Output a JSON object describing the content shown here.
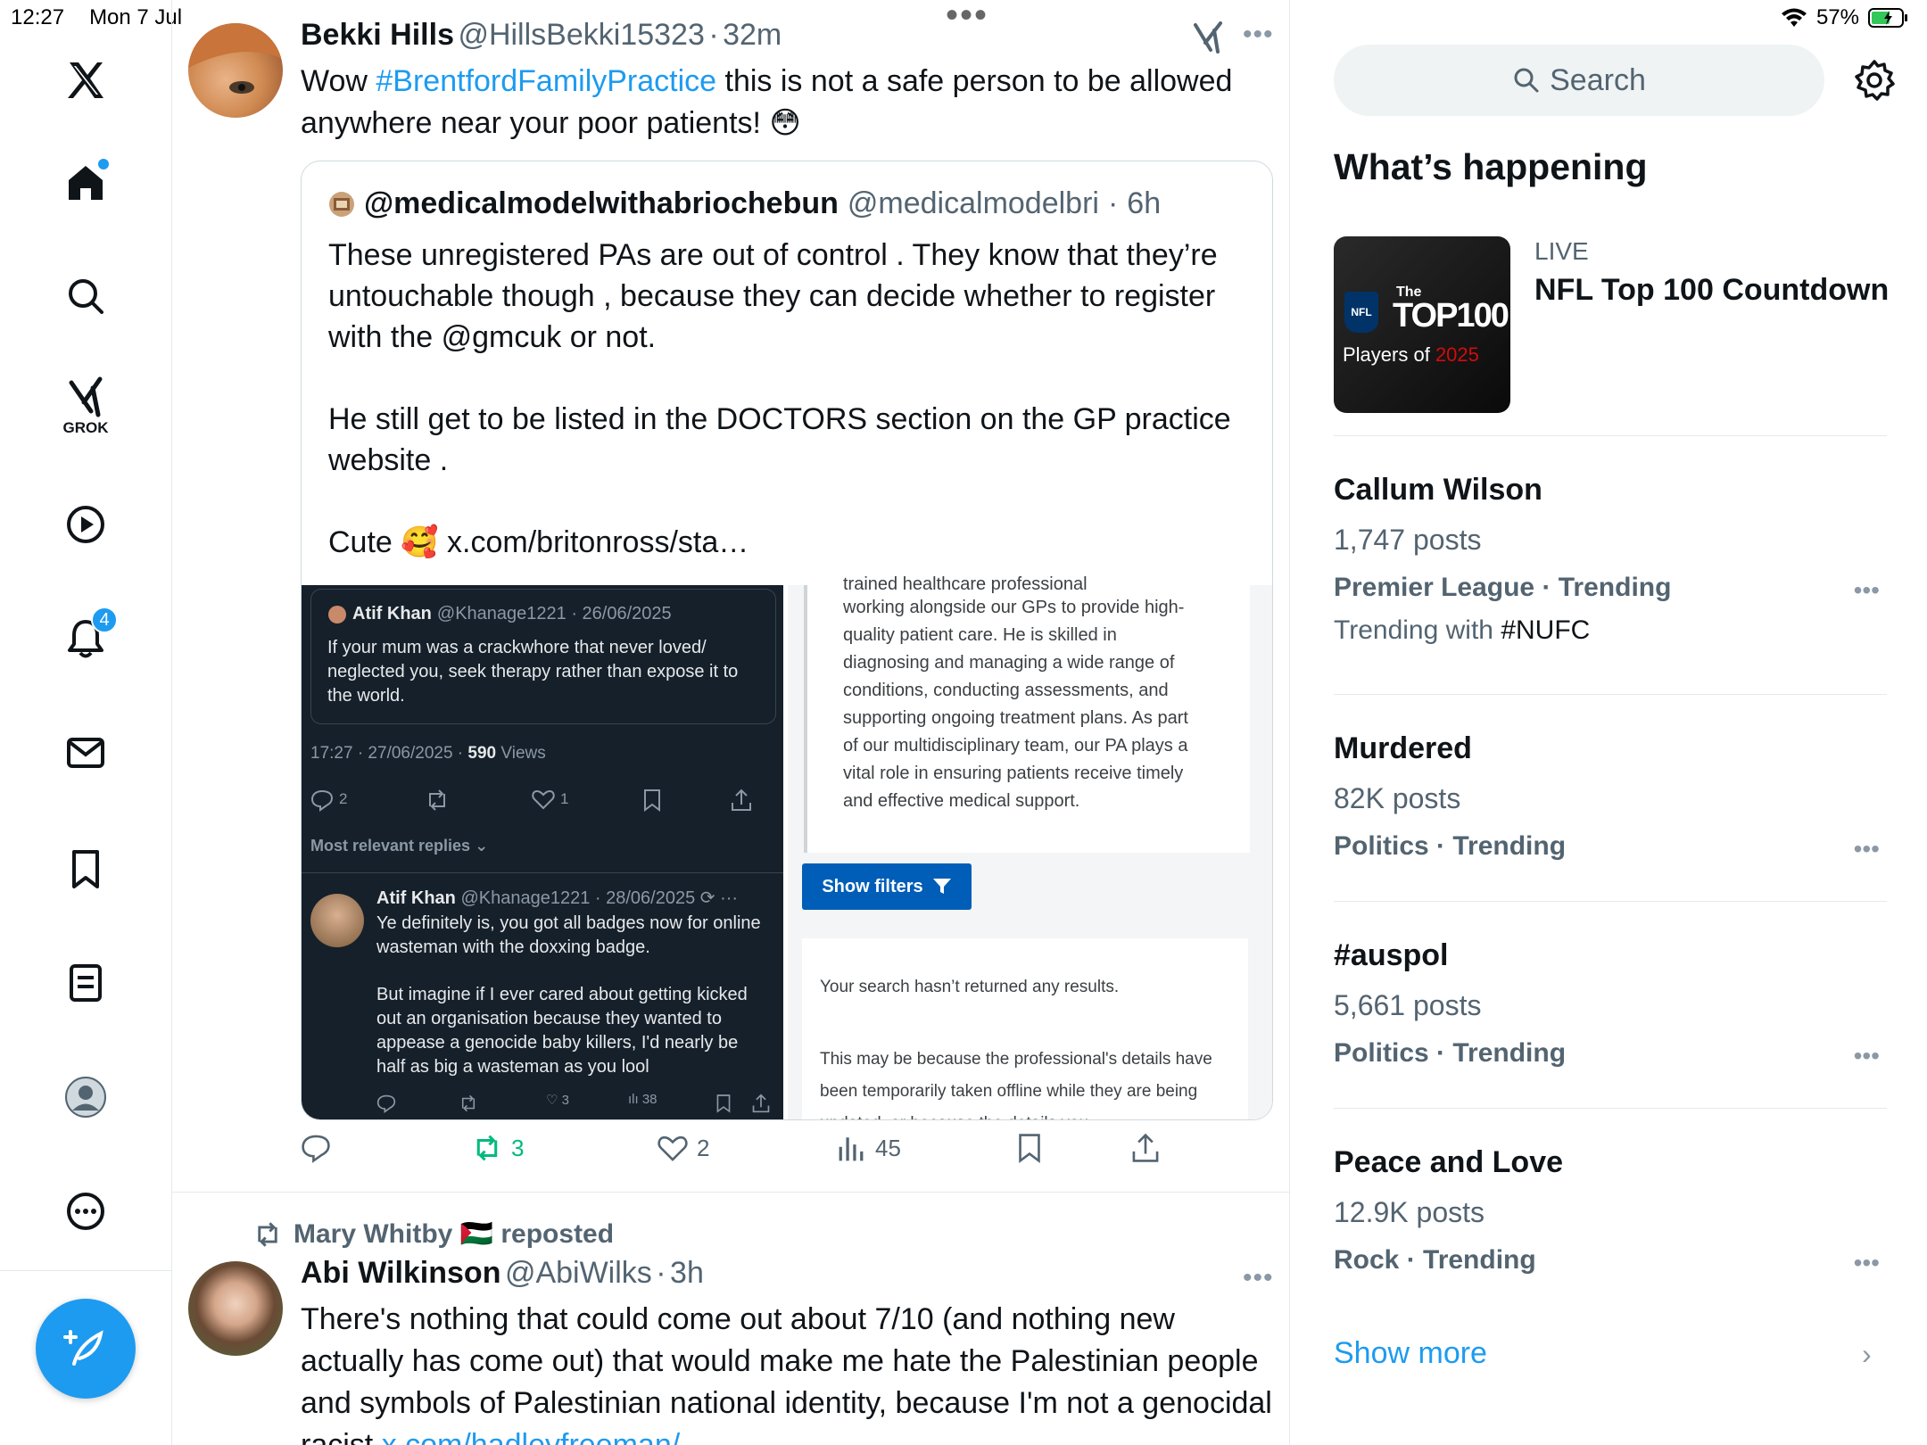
{
  "status": {
    "time": "12:27",
    "date": "Mon 7 Jul",
    "battery": "57%"
  },
  "nav": {
    "grok_label": "GROK",
    "notifications_count": "4"
  },
  "tweet1": {
    "name": "Bekki Hills",
    "handle": "@HillsBekki15323",
    "time": "32m",
    "text_pre": "Wow ",
    "hashtag": "#BrentfordFamilyPractice",
    "text_post": " this is not a safe person to be allowed anywhere near your poor patients! 😳",
    "quote": {
      "name": "@medicalmodelwithabriochebun",
      "handle": "@medicalmodelbri",
      "time": "6h",
      "text": "These unregistered PAs are out of control . They know that they’re untouchable though , because they can decide whether to register with the @gmcuk or not.\n\nHe still get to be listed in the DOCTORS section on the GP practice website .\n\nCute 🥰 x.com/britonross/sta…"
    },
    "media_left": {
      "q_name": "Atif Khan",
      "q_handle": "@Khanage1221 · 26/06/2025",
      "q_text": "If your mum was a crackwhore that never loved/ neglected you, seek therapy rather than expose it to the world.",
      "timestamp": "17:27 · 27/06/2025 · ",
      "views_count": "590",
      "views_label": " Views",
      "reply_count": "2",
      "like_count": "1",
      "relevant": "Most relevant replies ⌄",
      "r_name": "Atif Khan",
      "r_handle": "@Khanage1221 · 28/06/2025",
      "r_text1": "Ye definitely is, you got all badges now for online wasteman with the doxxing badge.",
      "r_text2": "But imagine if I ever cared about getting kicked out an organisation because they wanted to appease a genocide baby killers, I'd nearly be half as big a wasteman as you lool",
      "r_likes": "3",
      "r_views": "38"
    },
    "media_right": {
      "cut_text": "trained healthcare professional",
      "text": "working alongside our GPs to provide high-quality patient care. He is skilled in diagnosing and managing a wide range of conditions, conducting assessments, and supporting ongoing treatment plans. As part of our multidisciplinary team, our PA plays a vital role in ensuring patients receive timely and effective medical support.",
      "filter_btn": "Show filters",
      "no_results": "Your search hasn’t returned any results.",
      "may_be": "This may be because the professional's details have been temporarily taken offline while they are being updated, or because the details you"
    },
    "retweets": "3",
    "likes": "2",
    "views": "45"
  },
  "tweet2": {
    "reposter": "Mary Whitby 🇵🇸 reposted",
    "name": "Abi Wilkinson",
    "handle": "@AbiWilks",
    "time": "3h",
    "text": "There's nothing that could come out about 7/10 (and nothing new actually has come out) that would make me hate the Palestinian people and symbols of Palestinian national identity, because I'm not a genocidal racist ",
    "link": "x.com/hadleyfreeman/…"
  },
  "sidebar": {
    "search_placeholder": "Search",
    "title": "What’s happening",
    "live": {
      "label": "LIVE",
      "title": "NFL Top 100 Countdown",
      "img_top": "The",
      "img_main": "TOP100",
      "img_sub1": "Players of ",
      "img_sub2": "2025",
      "img_logo": "NFL"
    },
    "trends": [
      {
        "name": "Callum Wilson",
        "posts": "1,747 posts",
        "category": "Premier League · Trending",
        "with_label": "Trending with ",
        "with_tag": "#NUFC"
      },
      {
        "name": "Murdered",
        "posts": "82K posts",
        "category": "Politics · Trending"
      },
      {
        "name": "#auspol",
        "posts": "5,661 posts",
        "category": "Politics · Trending"
      },
      {
        "name": "Peace and Love",
        "posts": "12.9K posts",
        "category": "Rock · Trending"
      }
    ],
    "show_more": "Show more"
  }
}
